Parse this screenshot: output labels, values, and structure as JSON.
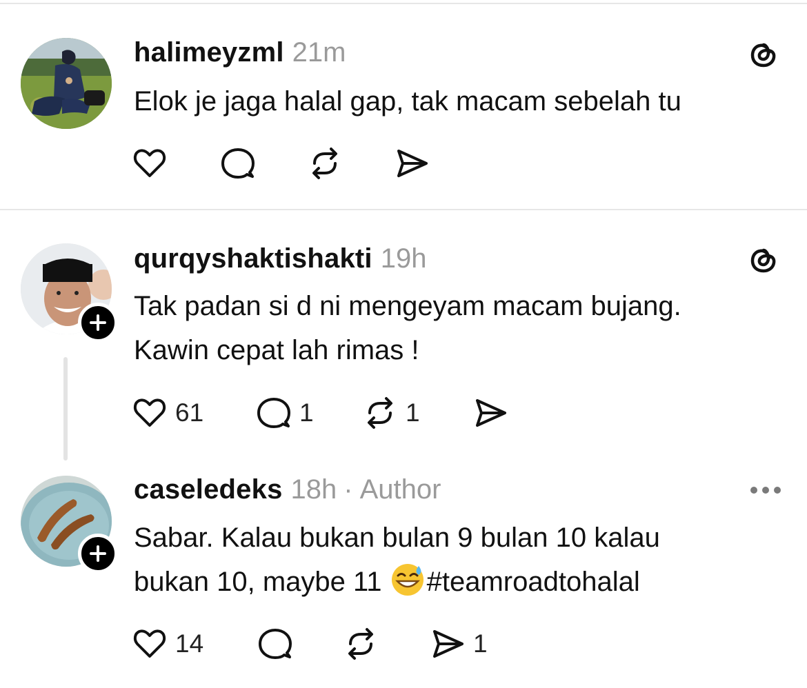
{
  "posts": [
    {
      "username": "halimeyzml",
      "time": "21m",
      "text_lines": [
        "Elok je jaga halal gap, tak macam sebelah tu"
      ],
      "actions": {
        "like_count": "",
        "reply_count": "",
        "repost_count": "",
        "share_count": ""
      }
    },
    {
      "username": "qurqyshaktishakti",
      "time": "19h",
      "text_lines": [
        "Tak padan si d ni mengeyam macam bujang.",
        "Kawin cepat lah rimas !"
      ],
      "actions": {
        "like_count": "61",
        "reply_count": "1",
        "repost_count": "1",
        "share_count": ""
      }
    },
    {
      "username": "caseledeks",
      "time": "18h",
      "separator": "·",
      "author_label": "Author",
      "text_lines": [
        "Sabar. Kalau bukan bulan 9 bulan 10 kalau",
        "bukan 10, maybe 11 ",
        "#teamroadtohalal"
      ],
      "actions": {
        "like_count": "14",
        "reply_count": "",
        "repost_count": "",
        "share_count": "1"
      }
    }
  ],
  "icons": {
    "like": "heart-icon",
    "reply": "comment-bubble-icon",
    "repost": "repost-icon",
    "share": "send-icon",
    "threads": "threads-logo-icon",
    "more": "more-options-icon",
    "follow": "plus-icon",
    "emoji": "grinning-face-with-sweat-emoji"
  },
  "colors": {
    "text": "#111111",
    "muted": "#9a9a9a",
    "divider": "#e6e6e6",
    "badge": "#000000"
  }
}
